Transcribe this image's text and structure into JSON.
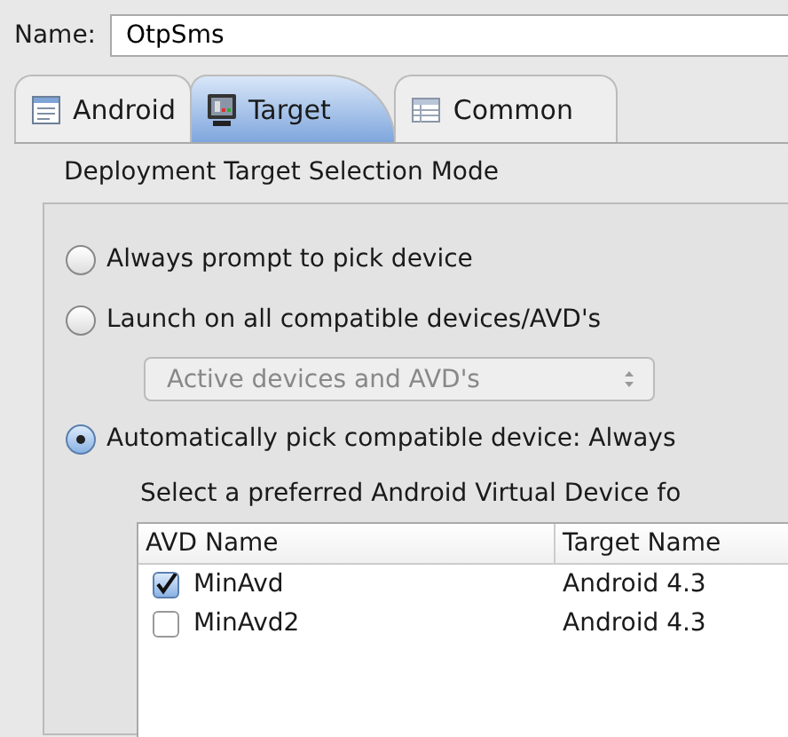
{
  "name_field": {
    "label": "Name:",
    "value": "OtpSms"
  },
  "tabs": [
    {
      "label": "Android",
      "selected": false
    },
    {
      "label": "Target",
      "selected": true
    },
    {
      "label": "Common",
      "selected": false
    }
  ],
  "group": {
    "title": "Deployment Target Selection Mode",
    "options": [
      {
        "kind": "radio",
        "label": "Always prompt to pick device",
        "selected": false
      },
      {
        "kind": "radio",
        "label": "Launch on all compatible devices/AVD's",
        "selected": false
      },
      {
        "kind": "dropdown",
        "value": "Active devices and AVD's",
        "disabled": true
      },
      {
        "kind": "radio",
        "label": "Automatically pick compatible device: Always",
        "selected": true
      }
    ],
    "avd_prompt": "Select a preferred Android Virtual Device fo",
    "table": {
      "columns": [
        "AVD Name",
        "Target Name"
      ],
      "rows": [
        {
          "checked": true,
          "cells": [
            "MinAvd",
            "Android 4.3"
          ]
        },
        {
          "checked": false,
          "cells": [
            "MinAvd2",
            "Android 4.3"
          ]
        }
      ]
    }
  }
}
